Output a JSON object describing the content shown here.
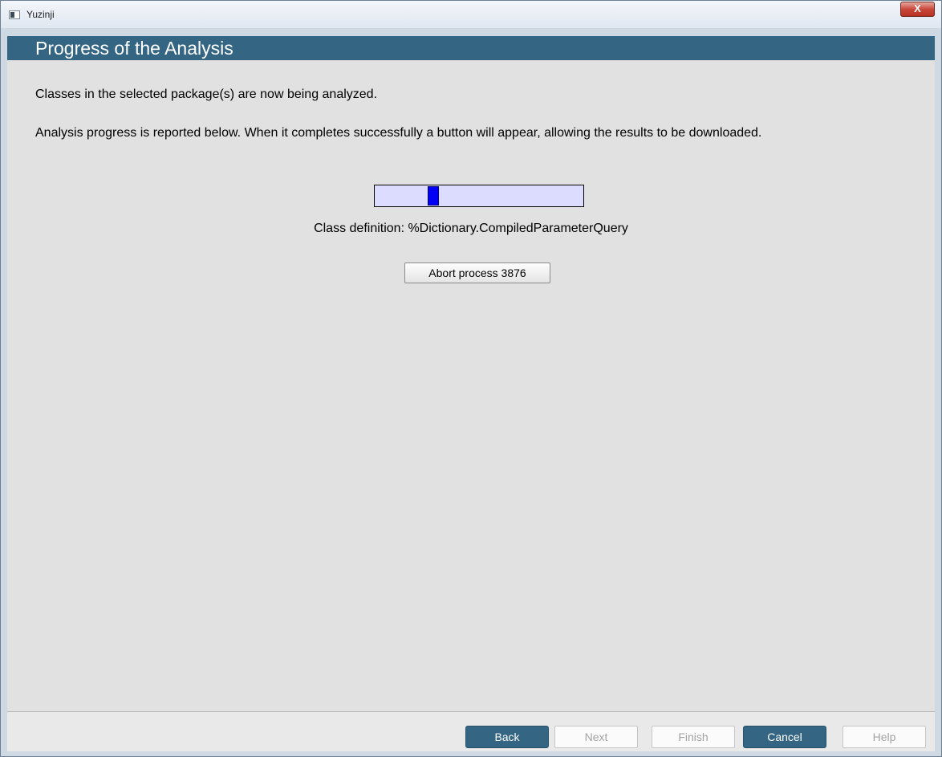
{
  "window": {
    "title": "Yuzinji",
    "close_icon": "close-icon",
    "close_glyph": "X"
  },
  "page": {
    "title": "Progress of the Analysis",
    "intro": "Classes in the selected package(s) are now being analyzed.",
    "explanation": "Analysis progress is reported below. When it completes successfully a button will appear, allowing the results to be downloaded."
  },
  "progress": {
    "indicator_position": 0.27,
    "status": "Class definition: %Dictionary.CompiledParameterQuery",
    "abort_label": "Abort process 3876"
  },
  "footer": {
    "back_label": "Back",
    "next_label": "Next",
    "finish_label": "Finish",
    "cancel_label": "Cancel",
    "help_label": "Help"
  },
  "colors": {
    "header_band": "#346583",
    "progress_track": "#dcdcff",
    "progress_thumb": "#0000f5",
    "content_bg": "#e1e1e1"
  }
}
